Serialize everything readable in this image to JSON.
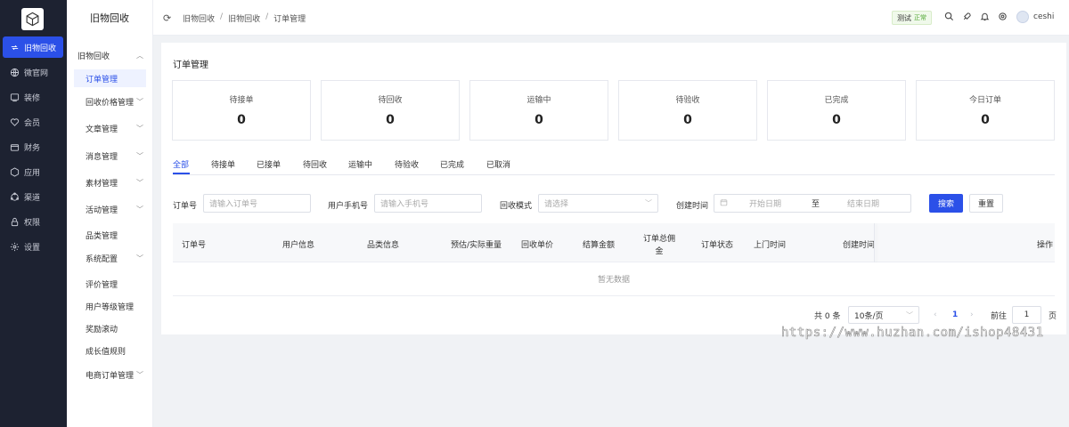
{
  "app": {
    "title": "旧物回收"
  },
  "rail": {
    "items": [
      {
        "label": "旧物回收",
        "active": true,
        "icon": "recycle-icon"
      },
      {
        "label": "微官网",
        "icon": "globe-icon"
      },
      {
        "label": "装修",
        "icon": "layout-icon"
      },
      {
        "label": "会员",
        "icon": "heart-icon"
      },
      {
        "label": "财务",
        "icon": "wallet-icon"
      },
      {
        "label": "应用",
        "icon": "app-icon"
      },
      {
        "label": "渠道",
        "icon": "channel-icon"
      },
      {
        "label": "权限",
        "icon": "lock-icon"
      },
      {
        "label": "设置",
        "icon": "gear-icon"
      }
    ]
  },
  "sidebar": {
    "group": "旧物回收",
    "items": [
      {
        "label": "订单管理",
        "active": true
      },
      {
        "label": "回收价格管理",
        "expandable": true
      },
      {
        "label": "文章管理",
        "expandable": true
      },
      {
        "label": "消息管理",
        "expandable": true
      },
      {
        "label": "素材管理",
        "expandable": true
      },
      {
        "label": "活动管理",
        "expandable": true
      },
      {
        "label": "品类管理"
      },
      {
        "label": "系统配置",
        "expandable": true
      },
      {
        "label": "评价管理"
      },
      {
        "label": "用户等级管理"
      },
      {
        "label": "奖励滚动"
      },
      {
        "label": "成长值规则"
      },
      {
        "label": "电商订单管理",
        "expandable": true
      }
    ]
  },
  "breadcrumb": [
    "旧物回收",
    "旧物回收",
    "订单管理"
  ],
  "topbar": {
    "env_label": "测试",
    "env_status": "正常",
    "username": "ceshi"
  },
  "page": {
    "title": "订单管理"
  },
  "stats": [
    {
      "label": "待接单",
      "value": "0"
    },
    {
      "label": "待回收",
      "value": "0"
    },
    {
      "label": "运输中",
      "value": "0"
    },
    {
      "label": "待验收",
      "value": "0"
    },
    {
      "label": "已完成",
      "value": "0"
    },
    {
      "label": "今日订单",
      "value": "0"
    }
  ],
  "tabs": [
    "全部",
    "待接单",
    "已接单",
    "待回收",
    "运输中",
    "待验收",
    "已完成",
    "已取消"
  ],
  "filters": {
    "order_no": {
      "label": "订单号",
      "placeholder": "请输入订单号"
    },
    "phone": {
      "label": "用户手机号",
      "placeholder": "请输入手机号"
    },
    "mode": {
      "label": "回收模式",
      "placeholder": "请选择"
    },
    "created": {
      "label": "创建时间",
      "start": "开始日期",
      "to": "至",
      "end": "结束日期"
    },
    "search_label": "搜索",
    "reset_label": "重置"
  },
  "table": {
    "columns": [
      "订单号",
      "用户信息",
      "品类信息",
      "预估/实际重量",
      "回收单价",
      "结算金额",
      "订单总佣金",
      "订单状态",
      "上门时间",
      "创建时间",
      "操作"
    ],
    "empty_text": "暂无数据"
  },
  "pagination": {
    "total_text": "共 0 条",
    "page_size": "10条/页",
    "current_page": "1",
    "goto_label": "前往",
    "goto_value": "1",
    "page_suffix": "页"
  },
  "watermark": "https://www.huzhan.com/ishop48431",
  "colors": {
    "accent": "#2b50e8",
    "rail_bg": "#1d2231"
  }
}
